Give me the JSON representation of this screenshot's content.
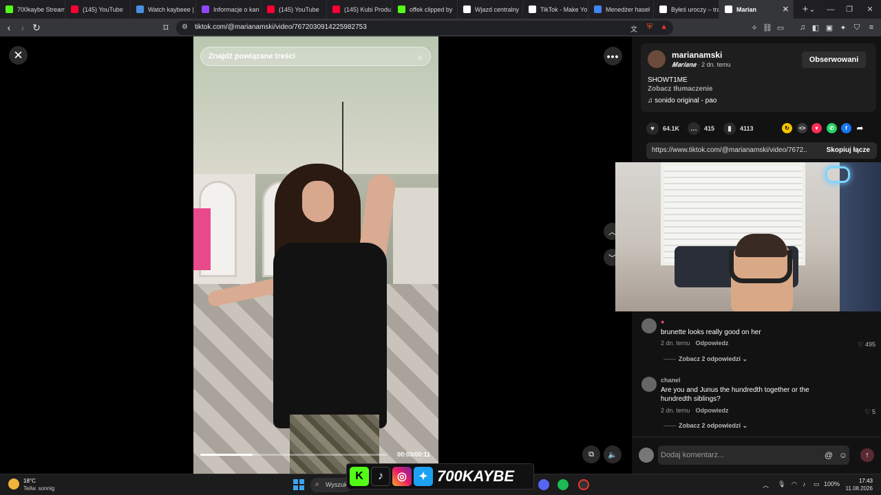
{
  "tabs": [
    {
      "title": "700kaybe Stream",
      "favicon": "kick-icon",
      "color": "#53fc18"
    },
    {
      "title": "(145) YouTube",
      "favicon": "youtube-icon",
      "color": "#ff0033"
    },
    {
      "title": "Watch kaybeee |",
      "favicon": "globe-icon",
      "color": "#4a90e2"
    },
    {
      "title": "Informacje o kan",
      "favicon": "twitch-icon",
      "color": "#9146ff"
    },
    {
      "title": "(145) YouTube",
      "favicon": "youtube-icon",
      "color": "#ff0033"
    },
    {
      "title": "(145) Kubi Produ",
      "favicon": "youtube-icon",
      "color": "#ff0033"
    },
    {
      "title": "offek clipped by",
      "favicon": "kick-icon",
      "color": "#53fc18"
    },
    {
      "title": "Wjazd centralny",
      "favicon": "tiktok-icon",
      "color": "#ffffff"
    },
    {
      "title": "TikTok - Make Yo",
      "favicon": "tiktok-icon",
      "color": "#ffffff"
    },
    {
      "title": "Menedżer haseł",
      "favicon": "google-icon",
      "color": "#4285f4"
    },
    {
      "title": "Byłeś uroczy – tra",
      "favicon": "tiktok-icon",
      "color": "#ffffff"
    },
    {
      "title": "Marian",
      "favicon": "tiktok-icon",
      "color": "#ffffff",
      "active": true
    }
  ],
  "address": {
    "url": "tiktok.com/@marianamski/video/7672030914225982753"
  },
  "viewer": {
    "search_placeholder": "Znajdź powiązane treści",
    "timecode": "00:03/00:11",
    "progress": 0.28
  },
  "author": {
    "username": "marianamski",
    "nickname": "𝑴𝒂𝒓𝒊𝒂𝒏𝒂",
    "time_ago": " · 2 dn. temu",
    "follow_label": "Obserwowani",
    "caption": "SHOWT1ME",
    "see_translation": "Zobacz tłumaczenie",
    "music": "sonido original - pao"
  },
  "stats": {
    "likes": "64.1K",
    "comments": "415",
    "saves": "4113"
  },
  "share": {
    "link": "https://www.tiktok.com/@marianamski/video/7672...",
    "copy_label": "Skopiuj łącze"
  },
  "comments": [
    {
      "user": "",
      "text": "brunette looks really good on her",
      "time": "2 dn. temu",
      "reply_label": "Odpowiedz",
      "likes": "495",
      "more_replies": "Zobacz 2 odpowiedzi ⌄"
    },
    {
      "user": "chanel",
      "text": "Are you and Junus the hundredth together or the hundredth siblings?",
      "time": "2 dn. temu",
      "reply_label": "Odpowiedz",
      "likes": "5",
      "more_replies": "Zobacz 2 odpowiedzi ⌄"
    }
  ],
  "comment_bar": {
    "placeholder": "Dodaj komentarz..."
  },
  "taskbar": {
    "temp": "18°C",
    "weather": "Teilw. sonnig",
    "search": "Wyszuk",
    "brand": "700KAYBE",
    "battery": "100%",
    "time": "17:43",
    "date": "11.08.2026"
  }
}
